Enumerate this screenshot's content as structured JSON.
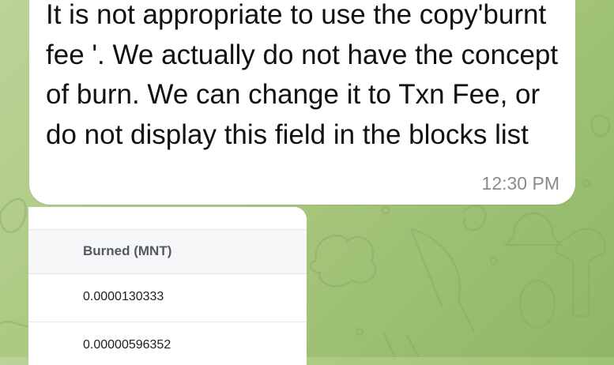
{
  "message": {
    "text": "It is not appropriate to use the copy'burnt fee '. We actually do not have the concept of burn. We can change it to Txn Fee, or do not display this field in the blocks list",
    "time": "12:30 PM"
  },
  "screenshot_table": {
    "header": "Burned (MNT)",
    "rows": [
      "0.0000130333",
      "0.00000596352"
    ]
  },
  "colors": {
    "background": "#a9c87f",
    "bubble": "#ffffff",
    "time_text": "#8a8a8e"
  }
}
